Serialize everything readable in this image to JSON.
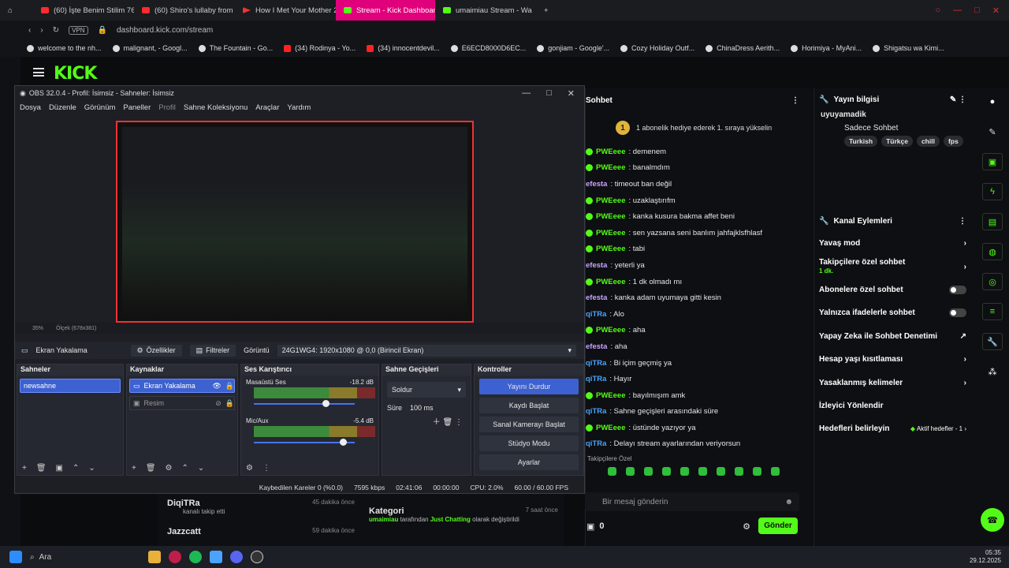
{
  "browser": {
    "tabs": [
      {
        "label": "(60) İşte Benim Stilim 76. E"
      },
      {
        "label": "(60) Shiro's lullaby from D"
      },
      {
        "label": "How I Met Your Mother 2."
      },
      {
        "label": "Stream - Kick Dashboard"
      },
      {
        "label": "umaimiau Stream - Wa"
      }
    ],
    "url": "dashboard.kick.com/stream",
    "vpn": "VPN",
    "bookmarks": [
      "welcome to the nh...",
      "malignant, - Googl...",
      "The Fountain - Go...",
      "(34) Rodinya - Yo...",
      "(34) innocentdevil...",
      "E6ECD8000D6EC...",
      "gonjiam - Google'...",
      "Cozy Holiday Outf...",
      "ChinaDress Aerith...",
      "Horimiya - MyAni...",
      "Shigatsu wa Kimi..."
    ]
  },
  "kick": {
    "logo": "KICK"
  },
  "obs": {
    "title": "OBS 32.0.4 - Profil: İsimsiz - Sahneler: İsimsiz",
    "menu": [
      "Dosya",
      "Düzenle",
      "Görünüm",
      "Paneller",
      "Profil",
      "Sahne Koleksiyonu",
      "Araçlar",
      "Yardım"
    ],
    "zoom": "35%",
    "scale": "Ölçek (678x381)",
    "source_bar": {
      "name": "Ekran Yakalama",
      "props": "Özellikler",
      "filters": "Filtreler",
      "display_label": "Görüntü",
      "display_value": "24G1WG4: 1920x1080 @ 0,0 (Birincil Ekran)"
    },
    "scenes": {
      "title": "Sahneler",
      "items": [
        "newsahne"
      ]
    },
    "sources": {
      "title": "Kaynaklar",
      "items": [
        "Ekran Yakalama",
        "Resim"
      ]
    },
    "mixer": {
      "title": "Ses Karıştırıcı",
      "ch1": "Masaüstü Ses",
      "ch1_db": "-18.2 dB",
      "ch2": "Mic/Aux",
      "ch2_db": "-5.4 dB"
    },
    "transitions": {
      "title": "Sahne Geçişleri",
      "type": "Soldur",
      "dur_label": "Süre",
      "dur_value": "100 ms"
    },
    "controls": {
      "title": "Kontroller",
      "stop": "Yayını Durdur",
      "record": "Kaydı Başlat",
      "vcam": "Sanal Kamerayı Başlat",
      "studio": "Stüdyo Modu",
      "settings": "Ayarlar"
    },
    "status": {
      "dropped": "Kaybedilen Kareler 0 (%0.0)",
      "kbps": "7595 kbps",
      "live": "02:41:06",
      "rec": "00:00:00",
      "cpu": "CPU: 2.0%",
      "fps": "60.00 / 60.00 FPS"
    }
  },
  "chat": {
    "title": "Sohbet",
    "pinned": "1 abonelik hediye ederek 1. sıraya yükselin",
    "pinned_rank": "1",
    "messages": [
      {
        "u": "PWEeee",
        "t": ": demenem"
      },
      {
        "u": "PWEeee",
        "t": ": banalmdım"
      },
      {
        "u": "efesta",
        "t": ": timeout ban değil"
      },
      {
        "u": "PWEeee",
        "t": ": uzaklaştırıfm"
      },
      {
        "u": "PWEeee",
        "t": ": kanka kusura bakma affet beni"
      },
      {
        "u": "PWEeee",
        "t": ": sen yazsana seni banlım jahfajklsfhlasf"
      },
      {
        "u": "PWEeee",
        "t": ": tabi"
      },
      {
        "u": "efesta",
        "t": ": yeterli ya"
      },
      {
        "u": "PWEeee",
        "t": ": 1 dk olmadı mı"
      },
      {
        "u": "efesta",
        "t": ": kanka adam uyumaya gitti kesin"
      },
      {
        "u": "qiTRa",
        "t": ": Alo"
      },
      {
        "u": "PWEeee",
        "t": ": aha"
      },
      {
        "u": "efesta",
        "t": ": aha"
      },
      {
        "u": "qiTRa",
        "t": ": Bi içim geçmiş ya"
      },
      {
        "u": "qiTRa",
        "t": ": Hayır"
      },
      {
        "u": "PWEeee",
        "t": ": bayılmışım amk"
      },
      {
        "u": "qiTRa",
        "t": ": Sahne geçişleri arasındaki süre"
      },
      {
        "u": "PWEeee",
        "t": ": üstünde yazıyor ya"
      },
      {
        "u": "qiTRa",
        "t": ": Delayı stream ayarlarından veriyorsun"
      }
    ],
    "emote_label": "Takipçilere Özel",
    "input_placeholder": "Bir mesaj gönderin",
    "count": "0",
    "send": "Gönder"
  },
  "stream_info": {
    "title": "Yayın bilgisi",
    "name": "uyuyamadik",
    "category": "Sadece Sohbet",
    "tags": [
      "Turkish",
      "Türkçe",
      "chill",
      "fps"
    ]
  },
  "channel_actions": {
    "title": "Kanal Eylemleri",
    "slow": "Yavaş mod",
    "followers": "Takipçilere özel sohbet",
    "followers_sub": "1 dk.",
    "subs": "Abonelere özel sohbet",
    "emotes": "Yalnızca ifadelerle sohbet",
    "ai": "Yapay Zeka ile Sohbet Denetimi",
    "age": "Hesap yaşı kısıtlaması",
    "banned": "Yasaklanmış kelimeler",
    "redirect": "İzleyici Yönlendir",
    "goals": "Hedefleri belirleyin",
    "goals_active": "Aktif hedefler - 1"
  },
  "activity": [
    {
      "name": "DiqiTRa",
      "sub": "kanalı takip etti",
      "time": "45 dakika önce"
    },
    {
      "name": "Jazzcatt",
      "sub": "",
      "time": "59 dakika önce"
    }
  ],
  "category_feed": {
    "title": "Kategori",
    "time": "7 saat önce",
    "user": "umaimiau",
    "mid": " tarafından ",
    "cat": "Just Chatting",
    "end": " olarak değiştirildi"
  },
  "taskbar": {
    "search": "Ara",
    "time": "05:35",
    "date": "29.12.2025"
  },
  "colors": {
    "kick_green": "#53fc18",
    "obs_blue": "#3d61d1",
    "tab_active": "#e0007c"
  }
}
